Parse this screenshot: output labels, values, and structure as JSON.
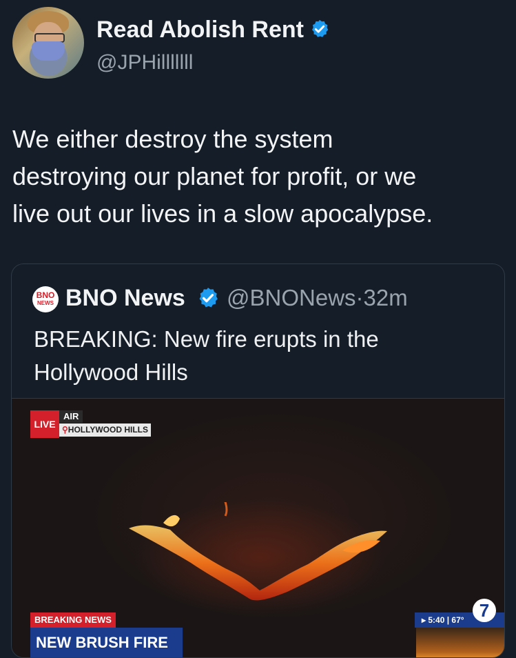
{
  "author": {
    "name": "Read Abolish Rent",
    "handle": "@JPHilllllll"
  },
  "tweet": {
    "text_lines": [
      "We either destroy the system",
      "destroying our planet for profit, or we",
      "live out our lives in a slow apocalypse."
    ]
  },
  "quoted": {
    "logo_top": "BNO",
    "logo_bottom": "NEWS",
    "name": "BNO News",
    "meta": "@BNONews·32m",
    "text_lines": [
      "BREAKING: New fire erupts in the",
      "Hollywood Hills"
    ],
    "media": {
      "live_label": "LIVE",
      "air_label": "AIR 7",
      "location": "HOLLYWOOD HILLS",
      "breaking_label": "BREAKING NEWS",
      "headline": "NEW BRUSH FIRE",
      "clock": "▸ 5:40 | 67°",
      "station": "7"
    }
  },
  "colors": {
    "background": "#151d28",
    "verified": "#1d9bf0",
    "secondary_text": "#9aa4ae"
  }
}
